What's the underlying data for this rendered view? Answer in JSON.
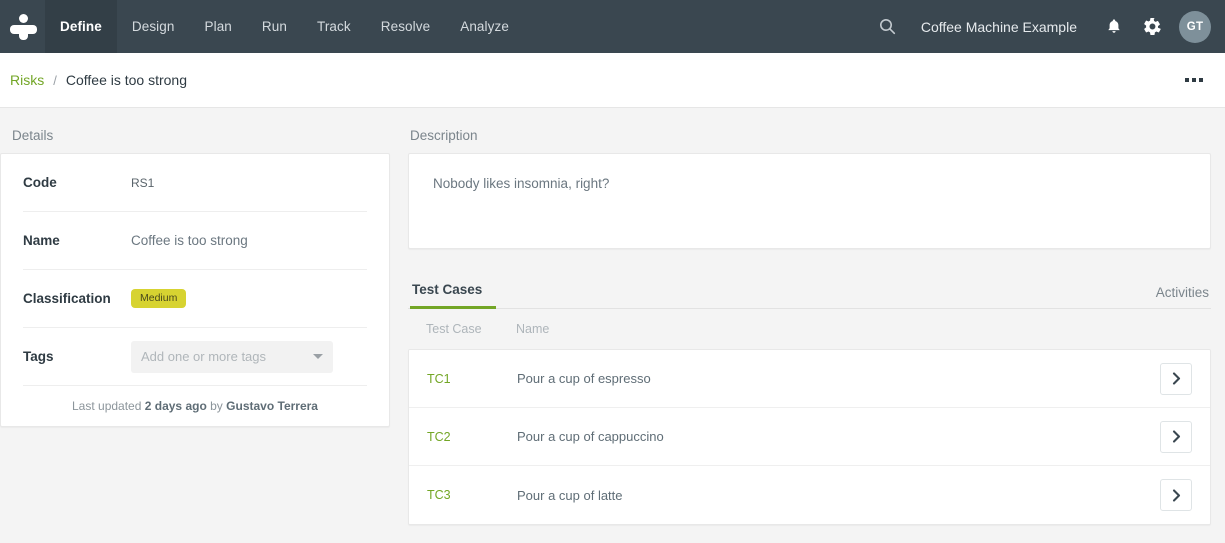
{
  "topnav": {
    "logo": "people-logo",
    "items": [
      {
        "label": "Define",
        "active": true
      },
      {
        "label": "Design",
        "active": false
      },
      {
        "label": "Plan",
        "active": false
      },
      {
        "label": "Run",
        "active": false
      },
      {
        "label": "Track",
        "active": false
      },
      {
        "label": "Resolve",
        "active": false
      },
      {
        "label": "Analyze",
        "active": false
      }
    ],
    "search_icon": "search-icon",
    "project_name": "Coffee Machine Example",
    "bell_icon": "bell-icon",
    "gear_icon": "gear-icon",
    "avatar_initials": "GT"
  },
  "breadcrumb": {
    "parent": "Risks",
    "separator": "/",
    "current": "Coffee is too strong",
    "more_icon": "overflow-menu-icon"
  },
  "details": {
    "section_label": "Details",
    "rows": [
      {
        "label": "Code",
        "value": "RS1"
      },
      {
        "label": "Name",
        "value": "Coffee is too strong"
      },
      {
        "label": "Classification",
        "value": "Medium"
      },
      {
        "label": "Tags",
        "value": "Add one or more tags"
      }
    ],
    "classification_badge": "Medium",
    "tags_placeholder": "Add one or more tags",
    "footer": {
      "prefix": "Last updated",
      "time": "2 days ago",
      "by": "by",
      "user": "Gustavo Terrera"
    }
  },
  "description": {
    "section_label": "Description",
    "text": "Nobody likes insomnia, right?"
  },
  "tabs": [
    {
      "label": "Test Cases",
      "active": true
    },
    {
      "label": "Activities",
      "active": false
    }
  ],
  "test_cases_table": {
    "columns": [
      "Test Case",
      "Name"
    ],
    "rows": [
      {
        "code": "TC1",
        "name": "Pour a cup of espresso",
        "action_icon": "chevron-right-icon"
      },
      {
        "code": "TC2",
        "name": "Pour a cup of cappuccino",
        "action_icon": "chevron-right-icon"
      },
      {
        "code": "TC3",
        "name": "Pour a cup of latte",
        "action_icon": "chevron-right-icon"
      }
    ]
  },
  "colors": {
    "nav_bg": "#3a4750",
    "nav_active_bg": "#333f47",
    "accent_green": "#73a626",
    "badge_yellow": "#d7d331",
    "page_bg": "#f4f4f4",
    "avatar_bg": "#7e909a"
  }
}
